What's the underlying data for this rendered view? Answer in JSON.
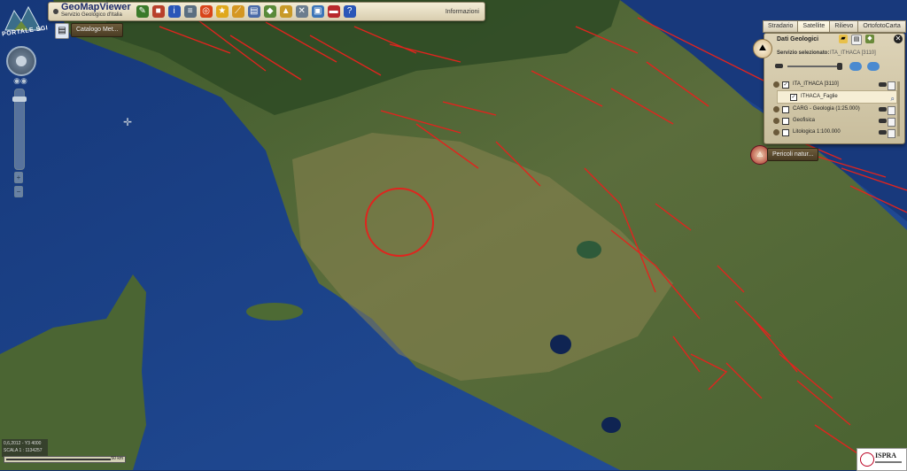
{
  "toolbar": {
    "title": "GeoMapViewer",
    "subtitle": "Servizio Geologico d'Italia",
    "info_label": "Informazioni",
    "tools": [
      {
        "icon": "draw-icon",
        "color": "#3a7a2a",
        "glyph": "✎"
      },
      {
        "icon": "layers-cube-icon",
        "color": "#b8402b",
        "glyph": "■"
      },
      {
        "icon": "info-icon",
        "color": "#2a56b8",
        "glyph": "i"
      },
      {
        "icon": "list-icon",
        "color": "#5a6e80",
        "glyph": "≡"
      },
      {
        "icon": "target-icon",
        "color": "#d8441a",
        "glyph": "◎"
      },
      {
        "icon": "star-icon",
        "color": "#e0a81c",
        "glyph": "★"
      },
      {
        "icon": "measure-icon",
        "color": "#d49622",
        "glyph": "⟋"
      },
      {
        "icon": "print-doc-icon",
        "color": "#4a6aa8",
        "glyph": "▤"
      },
      {
        "icon": "map-icon",
        "color": "#5a8a3a",
        "glyph": "◆"
      },
      {
        "icon": "pin-icon",
        "color": "#c89a28",
        "glyph": "▲"
      },
      {
        "icon": "tools-icon",
        "color": "#6b7d8e",
        "glyph": "✕"
      },
      {
        "icon": "monitor-icon",
        "color": "#3b74b8",
        "glyph": "▣"
      },
      {
        "icon": "flag-icon",
        "color": "#b8292c",
        "glyph": "▬"
      },
      {
        "icon": "help-icon",
        "color": "#2a56b8",
        "glyph": "?"
      }
    ]
  },
  "logo": {
    "text": "PORTALE SGI"
  },
  "catalog": {
    "label": "Catalogo Met..."
  },
  "base_tabs": [
    "Stradario",
    "Satellite",
    "Rilievo",
    "OrtofotoCarta"
  ],
  "active_tab": "Satellite",
  "panel": {
    "title": "Dati Geologici",
    "service_label": "Servizio selezionato:",
    "service_value": "ITA_ITHACA [3110]",
    "layers": [
      {
        "name": "ITA_ITHACA [3110]",
        "checked": true,
        "sub": false
      },
      {
        "name": "ITHACA_Faglie",
        "checked": true,
        "sub": true
      },
      {
        "name": "CARG - Geologia (1:25.000)",
        "checked": false,
        "sub": false
      },
      {
        "name": "Geofisica",
        "checked": false,
        "sub": false
      },
      {
        "name": "Litologica 1:100.000",
        "checked": false,
        "sub": false
      }
    ]
  },
  "pericoli": {
    "label": "Pericoli natur..."
  },
  "coords": {
    "line1": "0,6,2012 - Y3 4000",
    "line2": "SCALA 1 : 1134257"
  },
  "scale": {
    "label": "50 km"
  },
  "ispra": {
    "text": "ISPRA"
  },
  "colors": {
    "sea": "#1f4d96",
    "land": "#4f6b35",
    "faults": "#e0241e"
  }
}
